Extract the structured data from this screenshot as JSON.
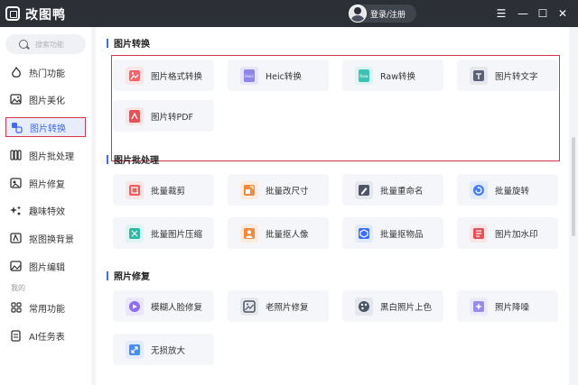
{
  "app": {
    "title": "改图鸭",
    "login_label": "登录/注册"
  },
  "window": {
    "menu": "☰",
    "minimize": "—",
    "maximize": "☐",
    "close": "✕"
  },
  "search": {
    "placeholder": "搜索功能"
  },
  "sidebar": {
    "items": [
      {
        "label": "热门功能",
        "icon": "fire-icon"
      },
      {
        "label": "图片美化",
        "icon": "image-icon"
      },
      {
        "label": "图片转换",
        "icon": "convert-icon",
        "active": true
      },
      {
        "label": "图片批处理",
        "icon": "batch-icon"
      },
      {
        "label": "照片修复",
        "icon": "repair-icon"
      },
      {
        "label": "趣味特效",
        "icon": "sparkle-icon"
      },
      {
        "label": "抠图换背景",
        "icon": "cutout-icon"
      },
      {
        "label": "图片编辑",
        "icon": "edit-icon"
      }
    ],
    "section_mine": "我的",
    "mine_items": [
      {
        "label": "常用功能",
        "icon": "grid-icon"
      },
      {
        "label": "AI任务表",
        "icon": "task-icon"
      }
    ]
  },
  "sections": [
    {
      "title": "图片转换",
      "cards": [
        {
          "label": "图片格式转换",
          "icon": "format-convert-icon",
          "color": "#f0646a"
        },
        {
          "label": "Heic转换",
          "icon": "heic-icon",
          "color": "#8e86e8"
        },
        {
          "label": "Raw转换",
          "icon": "raw-icon",
          "color": "#3ec2b3"
        },
        {
          "label": "图片转文字",
          "icon": "image-to-text-icon",
          "color": "#5a6275"
        },
        {
          "label": "图片转PDF",
          "icon": "pdf-icon",
          "color": "#e8505a"
        }
      ]
    },
    {
      "title": "图片批处理",
      "cards": [
        {
          "label": "批量裁剪",
          "icon": "crop-icon",
          "color": "#ef5d5d"
        },
        {
          "label": "批量改尺寸",
          "icon": "resize-icon",
          "color": "#f08a3c"
        },
        {
          "label": "批量重命名",
          "icon": "rename-icon",
          "color": "#4d5568"
        },
        {
          "label": "批量旋转",
          "icon": "rotate-icon",
          "color": "#4a7cf0"
        },
        {
          "label": "批量图片压缩",
          "icon": "compress-icon",
          "color": "#2fb8a6"
        },
        {
          "label": "批量抠人像",
          "icon": "portrait-icon",
          "color": "#f08a3c"
        },
        {
          "label": "批量抠物品",
          "icon": "object-icon",
          "color": "#3d6cf0"
        },
        {
          "label": "图片加水印",
          "icon": "watermark-icon",
          "color": "#e8505a"
        }
      ]
    },
    {
      "title": "照片修复",
      "cards": [
        {
          "label": "模糊人脸修复",
          "icon": "face-repair-icon",
          "color": "#8e6ef0"
        },
        {
          "label": "老照片修复",
          "icon": "old-photo-icon",
          "color": "#4d5568"
        },
        {
          "label": "黑白照片上色",
          "icon": "colorize-icon",
          "color": "#4d5568"
        },
        {
          "label": "照片降噪",
          "icon": "denoise-icon",
          "color": "#9a8ae8"
        },
        {
          "label": "无损放大",
          "icon": "upscale-icon",
          "color": "#4a8cf0"
        }
      ]
    }
  ]
}
